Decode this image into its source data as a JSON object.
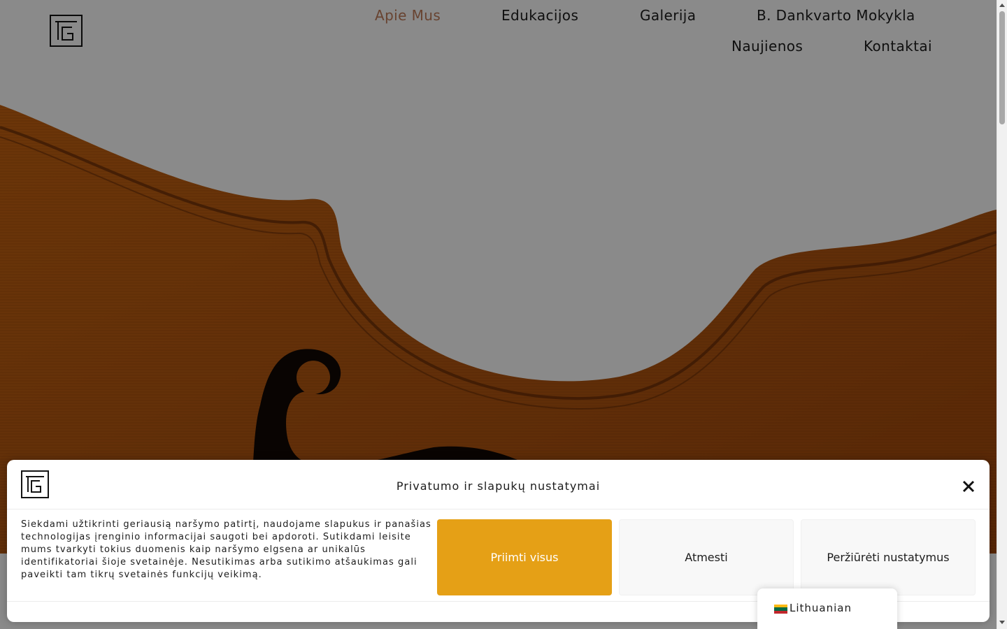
{
  "header": {
    "nav": [
      {
        "label": "Apie Mus",
        "active": true
      },
      {
        "label": "Edukacijos",
        "active": false
      },
      {
        "label": "Galerija",
        "active": false
      },
      {
        "label": "B. Dankvarto Mokykla",
        "active": false
      },
      {
        "label": "Naujienos",
        "active": false
      },
      {
        "label": "Kontaktai",
        "active": false
      }
    ]
  },
  "hero": {
    "image": "violin-body-closeup"
  },
  "cookie_banner": {
    "title": "Privatumo ir slapukų nustatymai",
    "text": "Siekdami užtikrinti geriausią naršymo patirtį, naudojame slapukus ir panašias technologijas įrenginio informacijai saugoti bei apdoroti. Sutikdami leisite mums tvarkyti tokius duomenis kaip naršymo elgsena ar unikalūs identifikatoriai šioje svetainėje. Nesutikimas arba sutikimo atšaukimas gali paveikti tam tikrų svetainės funkcijų veikimą.",
    "accept_label": "Priimti visus",
    "deny_label": "Atmesti",
    "prefs_label": "Peržiūrėti nustatymus",
    "close_icon": "close-icon"
  },
  "language_switcher": {
    "label": "Lithuanian",
    "flag_colors": [
      "#fdb913",
      "#006a44",
      "#c1272d"
    ]
  },
  "colors": {
    "accent": "#e5a016",
    "active_nav": "#c07c5a"
  }
}
